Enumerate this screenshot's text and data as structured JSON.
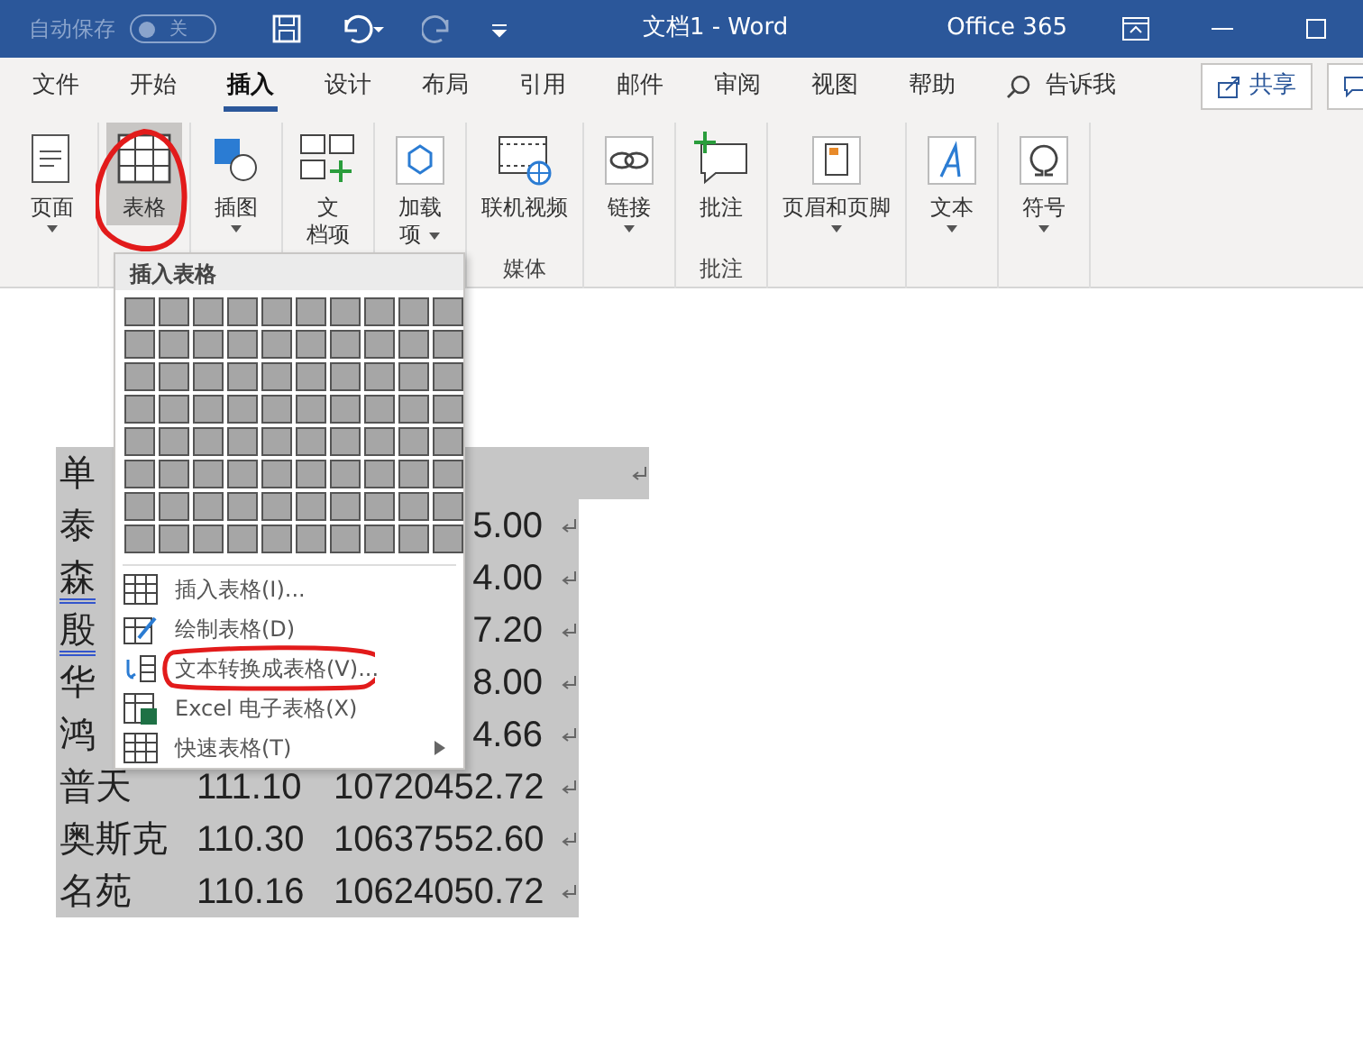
{
  "title_bar": {
    "autosave_label": "自动保存",
    "autosave_toggle": {
      "label": "关",
      "on": false
    },
    "redo_disabled": true,
    "title": "文档1  -  Word",
    "account": "Office 365"
  },
  "tabs": [
    {
      "label": "文件",
      "selected": false
    },
    {
      "label": "开始",
      "selected": false
    },
    {
      "label": "插入",
      "selected": true
    },
    {
      "label": "设计",
      "selected": false
    },
    {
      "label": "布局",
      "selected": false
    },
    {
      "label": "引用",
      "selected": false
    },
    {
      "label": "邮件",
      "selected": false
    },
    {
      "label": "审阅",
      "selected": false
    },
    {
      "label": "视图",
      "selected": false
    },
    {
      "label": "帮助",
      "selected": false
    }
  ],
  "tell_me": "告诉我",
  "share": "共享",
  "ribbon": [
    {
      "label": "页面",
      "dropdown": true,
      "selected": false,
      "circled": false
    },
    {
      "label": "表格",
      "dropdown": false,
      "selected": true,
      "circled": true
    },
    {
      "label": "插图",
      "dropdown": true,
      "selected": false,
      "circled": false
    },
    {
      "label_lines": [
        "文",
        "档项"
      ],
      "dropdown": false,
      "selected": false,
      "circled": false
    },
    {
      "label_lines": [
        "加载",
        "项"
      ],
      "dropdown": true,
      "selected": false,
      "circled": false
    },
    {
      "label": "联机视频",
      "dropdown": false,
      "selected": false,
      "circled": false,
      "group_label": "媒体"
    },
    {
      "label": "链接",
      "dropdown": true,
      "selected": false,
      "circled": false
    },
    {
      "label": "批注",
      "dropdown": false,
      "selected": false,
      "circled": false,
      "group_label": "批注"
    },
    {
      "label": "页眉和页脚",
      "dropdown": true,
      "selected": false,
      "circled": false
    },
    {
      "label": "文本",
      "dropdown": true,
      "selected": false,
      "circled": false
    },
    {
      "label": "符号",
      "dropdown": true,
      "selected": false,
      "circled": false
    }
  ],
  "table_menu": {
    "header": "插入表格",
    "items": [
      {
        "label": "插入表格(I)...",
        "circled": false,
        "submenu": false
      },
      {
        "label": "绘制表格(D)",
        "circled": false,
        "submenu": false
      },
      {
        "label": "文本转换成表格(V)...",
        "circled": true,
        "submenu": false
      },
      {
        "label": "Excel 电子表格(X)",
        "circled": false,
        "submenu": false
      },
      {
        "label": "快速表格(T)",
        "circled": false,
        "submenu": true
      }
    ]
  },
  "document_rows": [
    {
      "column_1": "单",
      "flagged": false,
      "wide": true
    },
    {
      "column_1": "泰",
      "column_3": "5.00",
      "flagged": false,
      "wide": false
    },
    {
      "column_1": "森",
      "column_3": "4.00",
      "flagged": true,
      "wide": false
    },
    {
      "column_1": "殷",
      "column_3": "7.20",
      "flagged": true,
      "wide": false
    },
    {
      "column_1": "华",
      "column_3": "8.00",
      "flagged": false,
      "wide": false
    },
    {
      "column_1": "鸿",
      "column_3": "4.66",
      "flagged": false,
      "wide": false
    },
    {
      "column_1": "普天",
      "column_2": "111.10",
      "column_3": "10720452.72",
      "flagged": false,
      "wide": false
    },
    {
      "column_1": "奥斯克",
      "column_2": "110.30",
      "column_3": "10637552.60",
      "flagged": false,
      "wide": false
    },
    {
      "column_1": "名苑",
      "column_2": "110.16",
      "column_3": "10624050.72",
      "flagged": false,
      "wide": false
    }
  ]
}
